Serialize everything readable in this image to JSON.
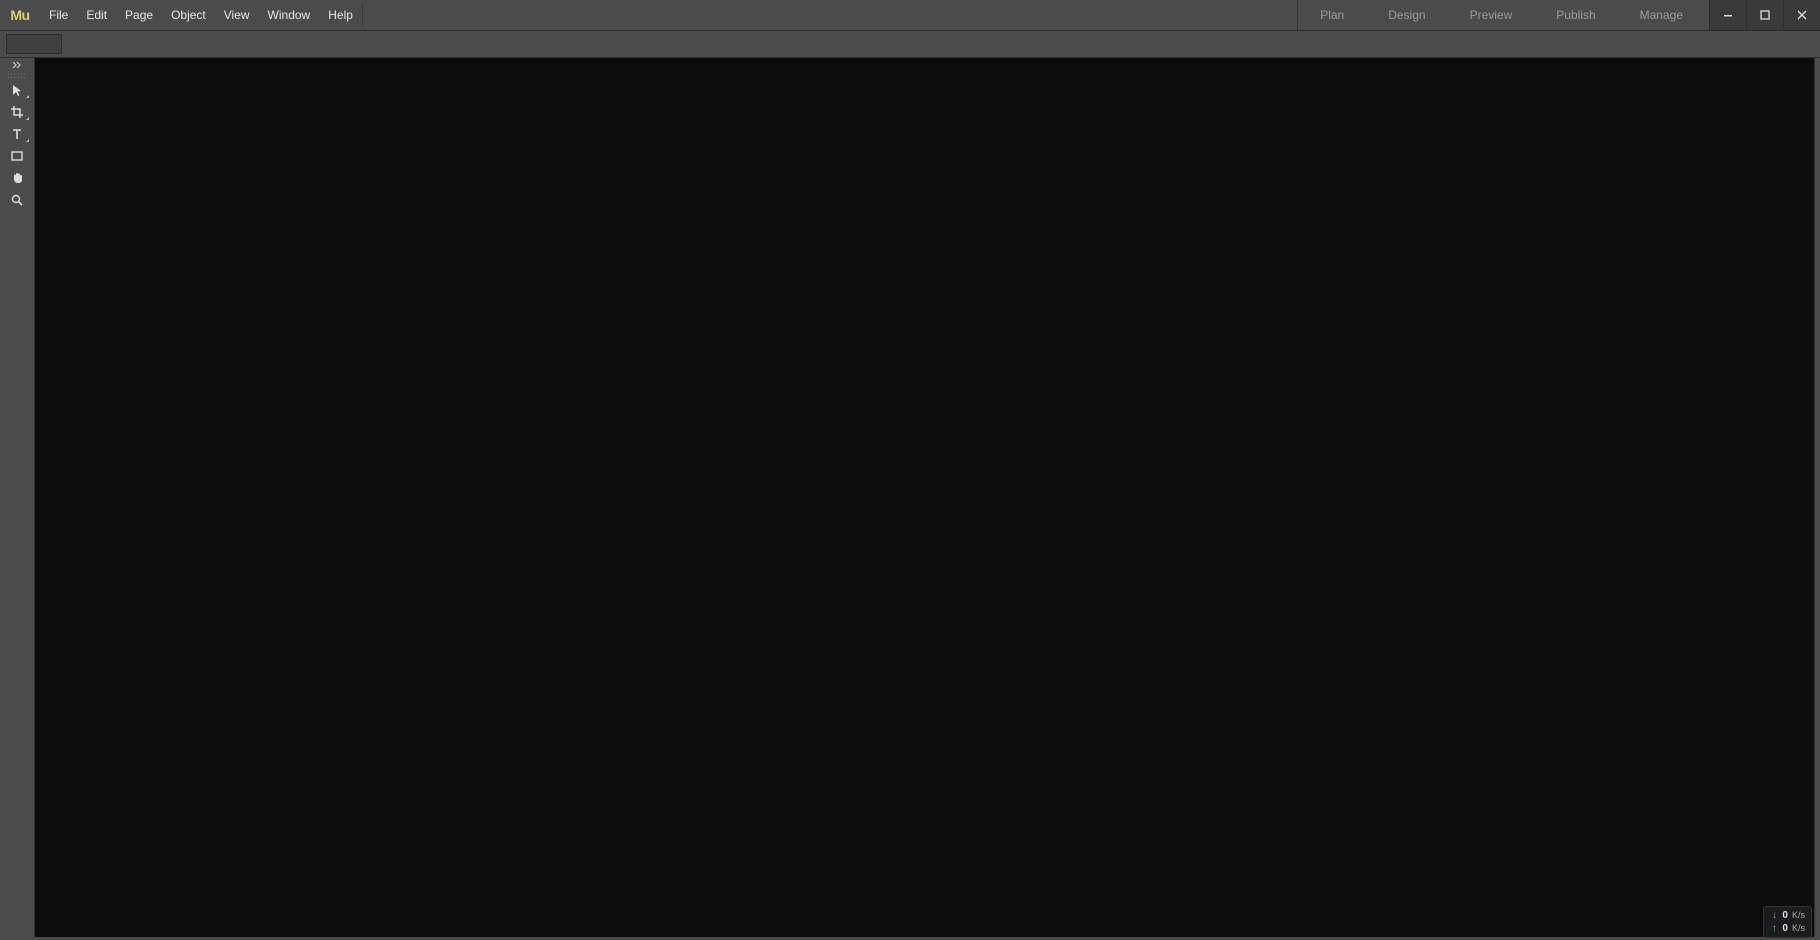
{
  "app": {
    "logo": "Mu"
  },
  "menu": {
    "items": [
      "File",
      "Edit",
      "Page",
      "Object",
      "View",
      "Window",
      "Help"
    ]
  },
  "mode_tabs": [
    "Plan",
    "Design",
    "Preview",
    "Publish",
    "Manage"
  ],
  "window_controls": {
    "minimize": "Minimize",
    "maximize": "Maximize",
    "close": "Close"
  },
  "control_bar": {
    "field_value": ""
  },
  "toolbar": {
    "collapse_label": "Collapse Panels",
    "tools": [
      {
        "name": "selection-tool",
        "icon": "selection"
      },
      {
        "name": "crop-tool",
        "icon": "crop"
      },
      {
        "name": "text-tool",
        "icon": "text"
      },
      {
        "name": "rectangle-tool",
        "icon": "rect"
      },
      {
        "name": "hand-tool",
        "icon": "hand"
      },
      {
        "name": "zoom-tool",
        "icon": "zoom"
      }
    ]
  },
  "network": {
    "down_value": "0",
    "down_unit": "K/s",
    "up_value": "0",
    "up_unit": "K/s"
  }
}
